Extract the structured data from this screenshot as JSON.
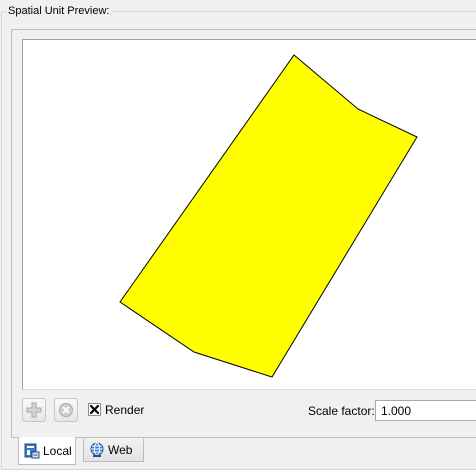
{
  "group": {
    "title": "Spatial Unit Preview:"
  },
  "preview": {
    "shape_fill": "#ffff00",
    "shape_stroke": "#000000"
  },
  "toolbar": {
    "add_icon": "plus-icon",
    "remove_icon": "remove-circle-icon",
    "render_label": "Render",
    "render_checked": true,
    "scale_label": "Scale factor:",
    "scale_value": "1.000"
  },
  "tabs": [
    {
      "label": "Local",
      "icon": "local-map-icon",
      "active": true
    },
    {
      "label": "Web",
      "icon": "web-globe-icon",
      "active": false
    }
  ]
}
